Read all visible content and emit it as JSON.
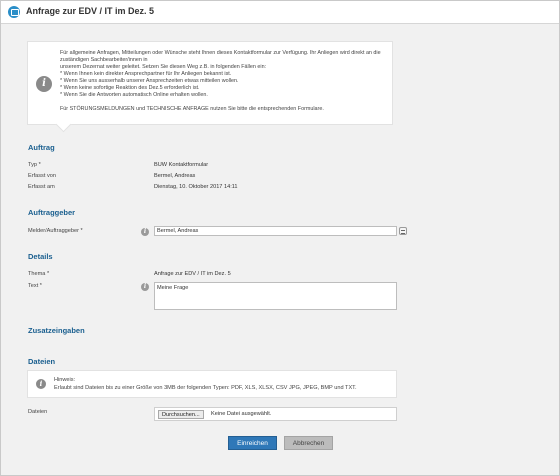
{
  "window": {
    "title": "Anfrage zur EDV / IT im Dez. 5",
    "icon": "monitor-icon"
  },
  "info": {
    "icon": "info-icon",
    "lines": [
      "Für allgemeine Anfragen, Mitteilungen oder Wünsche steht Ihnen dieses Kontaktformular zur Verfügung. Ihr Anliegen wird direkt an die zuständigen Sachbearbeiter/innen in",
      "unserem Dezernat weiter geleitet. Setzen Sie diesen Weg z.B. in folgenden Fällen ein:",
      "* Wenn Ihnen kein direkter Ansprechpartner für Ihr Anliegen bekannt ist.",
      "* Wenn Sie uns ausserhalb unserer Ansprechzeiten etwas mitteilen wollen.",
      "* Wenn keine sofortige Reaktion des Dez.5 erforderlich ist.",
      "* Wenn Sie die Antworten automatisch Online erhalten wollen."
    ],
    "footer": "Für STÖRUNGSMELDUNGEN und TECHNISCHE ANFRAGE nutzen Sie bitte die entsprechenden Formulare."
  },
  "auftrag": {
    "heading": "Auftrag",
    "typ_label": "Typ *",
    "typ_value": "BUW Kontaktformular",
    "erfasst_von_label": "Erfasst von",
    "erfasst_von_value": "Bermel, Andreas",
    "erfasst_am_label": "Erfasst am",
    "erfasst_am_value": "Dienstag, 10. Oktober 2017 14:11"
  },
  "auftraggeber": {
    "heading": "Auftraggeber",
    "melder_label": "Melder/Auftraggeber *",
    "melder_value": "Bermel, Andreas"
  },
  "details": {
    "heading": "Details",
    "thema_label": "Thema *",
    "thema_value": "Anfrage zur EDV / IT im Dez. 5",
    "text_label": "Text *",
    "text_value": "Meine Frage"
  },
  "zusatzeingaben": {
    "heading": "Zusatzeingaben"
  },
  "dateien": {
    "heading": "Dateien",
    "hint_title": "Hinweis:",
    "hint_text": "Erlaubt sind Dateien bis zu einer Größe von 3MB der folgenden Typen: PDF, XLS, XLSX, CSV JPG, JPEG, BMP und TXT.",
    "label": "Dateien",
    "browse_label": "Durchsuchen...",
    "status": "Keine Datei ausgewählt."
  },
  "actions": {
    "submit": "Einreichen",
    "cancel": "Abbrechen"
  }
}
